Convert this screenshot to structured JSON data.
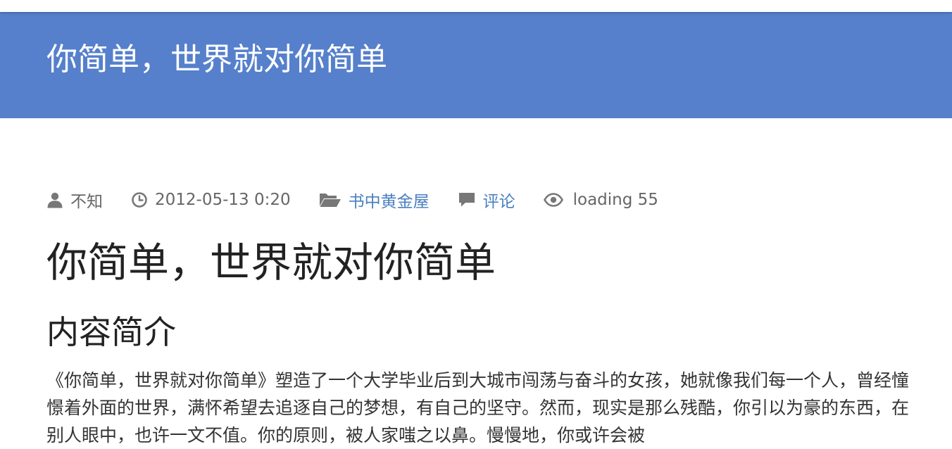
{
  "header": {
    "site_title": "你简单，世界就对你简单",
    "bg_color": "#5680cb"
  },
  "meta": {
    "author": "不知",
    "date": "2012-05-13 0:20",
    "category": "书中黄金屋",
    "comments": "评论",
    "views": "loading 55",
    "link_color": "#4a7fc1"
  },
  "post": {
    "title": "你简单，世界就对你简单",
    "section_title": "内容简介",
    "summary": "《你简单，世界就对你简单》塑造了一个大学毕业后到大城市闯荡与奋斗的女孩，她就像我们每一个人，曾经憧憬着外面的世界，满怀希望去追逐自己的梦想，有自己的坚守。然而，现实是那么残酷，你引以为豪的东西，在别人眼中，也许一文不值。你的原则，被人家嗤之以鼻。慢慢地，你或许会被"
  }
}
